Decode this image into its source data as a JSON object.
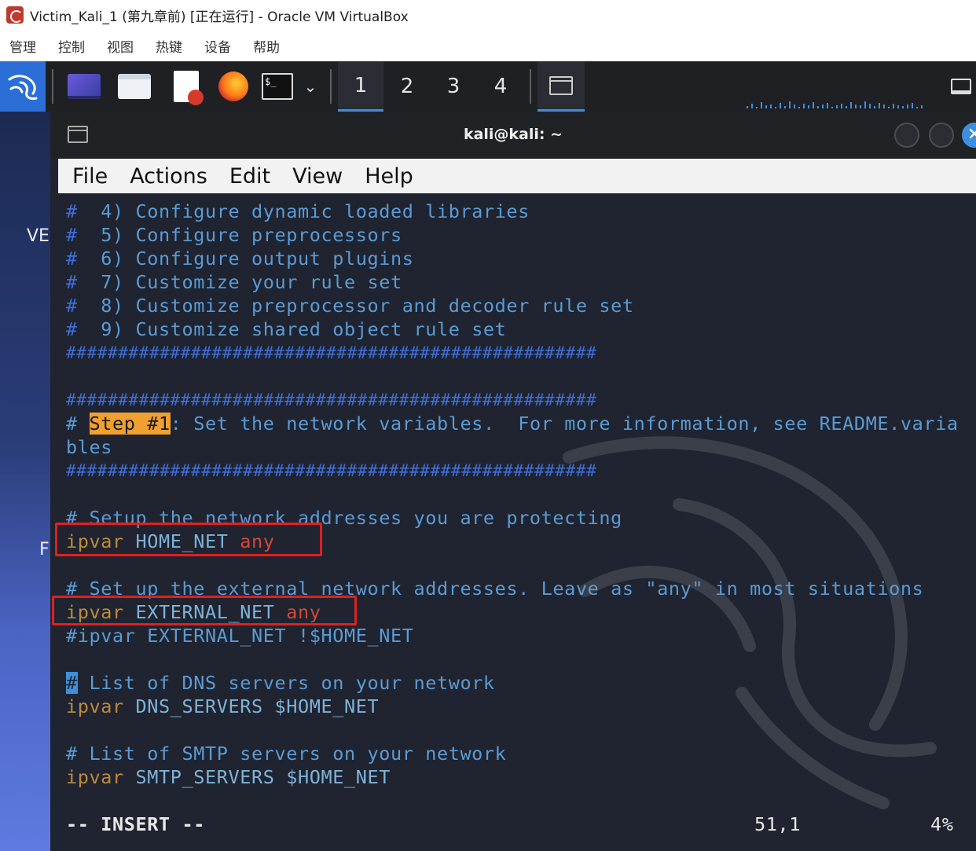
{
  "window": {
    "title": "Victim_Kali_1 (第九章前) [正在运行] - Oracle VM VirtualBox",
    "menu": [
      "管理",
      "控制",
      "视图",
      "热键",
      "设备",
      "帮助"
    ]
  },
  "panel": {
    "workspaces": [
      "1",
      "2",
      "3",
      "4"
    ],
    "active_workspace": "1"
  },
  "desktop": {
    "label_partial_1": "VE",
    "label_partial_2": "F"
  },
  "terminal": {
    "title": "kali@kali: ~",
    "menu": [
      "File",
      "Actions",
      "Edit",
      "View",
      "Help"
    ],
    "lines": {
      "l1_hash": "#",
      "l1_text": "  4) Configure dynamic loaded libraries",
      "l2_hash": "#",
      "l2_text": "  5) Configure preprocessors",
      "l3_hash": "#",
      "l3_text": "  6) Configure output plugins",
      "l4_hash": "#",
      "l4_text": "  7) Customize your rule set",
      "l5_hash": "#",
      "l5_text": "  8) Customize preprocessor and decoder rule set",
      "l6_hash": "#",
      "l6_text": "  9) Customize shared object rule set",
      "sep1": "###################################################",
      "sep2": "###################################################",
      "step_hash": "# ",
      "step_label": "Step #1",
      "step_text": ": Set the network variables.  For more information, see README.varia",
      "step_wrap": "bles",
      "sep3": "###################################################",
      "setup_comment": "# Setup the network addresses you are protecting",
      "home_kw": "ipvar",
      "home_name": " HOME_NET ",
      "home_val": "any",
      "ext_comment": "# Set up the external network addresses. Leave as \"any\" in most situations",
      "ext_kw": "ipvar",
      "ext_name": " EXTERNAL_NET ",
      "ext_val": "any",
      "ext_alt": "#ipvar EXTERNAL_NET !$HOME_NET",
      "dns_cursor": "#",
      "dns_comment": " List of DNS servers on your network",
      "dns_kw": "ipvar",
      "dns_rest": " DNS_SERVERS $HOME_NET",
      "smtp_comment": "# List of SMTP servers on your network",
      "smtp_kw": "ipvar",
      "smtp_rest": " SMTP_SERVERS $HOME_NET"
    },
    "status": {
      "mode": "-- INSERT --",
      "position": "51,1",
      "percent": "4%"
    }
  },
  "colors": {
    "terminal_bg": "#1f2430",
    "comment": "#5b9bd5",
    "keyword": "#c08a3a",
    "value_any": "#d8463a",
    "highlight": "#f0a030",
    "annotation_box": "#e02020",
    "accent": "#3d8fe0"
  }
}
